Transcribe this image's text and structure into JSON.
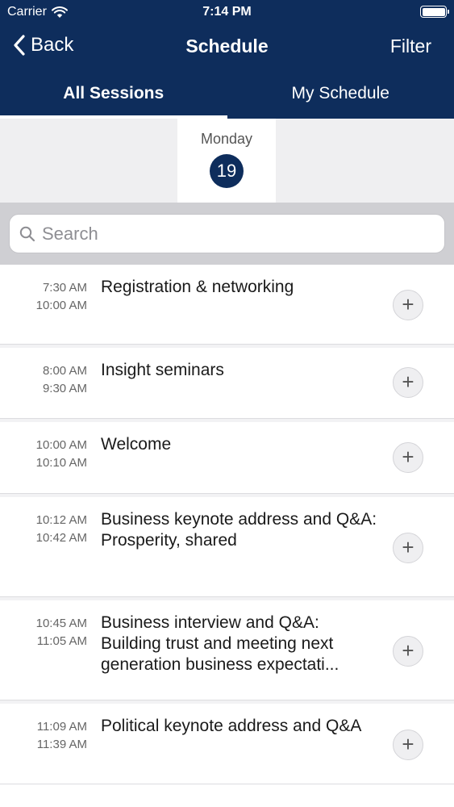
{
  "status": {
    "carrier": "Carrier",
    "time": "7:14 PM"
  },
  "nav": {
    "back_label": "Back",
    "title": "Schedule",
    "filter_label": "Filter"
  },
  "tabs": [
    {
      "label": "All Sessions",
      "active": true
    },
    {
      "label": "My Schedule",
      "active": false
    }
  ],
  "date": {
    "weekday": "Monday",
    "day": "19"
  },
  "search": {
    "placeholder": "Search"
  },
  "sessions": [
    {
      "start": "7:30 AM",
      "end": "10:00 AM",
      "title": "Registration & networking"
    },
    {
      "start": "8:00 AM",
      "end": "9:30 AM",
      "title": "Insight seminars"
    },
    {
      "start": "10:00 AM",
      "end": "10:10 AM",
      "title": "Welcome"
    },
    {
      "start": "10:12 AM",
      "end": "10:42 AM",
      "title": "Business keynote address and Q&A: Prosperity, shared"
    },
    {
      "start": "10:45 AM",
      "end": "11:05 AM",
      "title": "Business interview and Q&A: Building trust and meeting next generation business expectati..."
    },
    {
      "start": "11:09 AM",
      "end": "11:39 AM",
      "title": "Political keynote address and Q&A"
    }
  ],
  "colors": {
    "header_bg": "#0e2d5c",
    "accent": "#0e2d5c"
  },
  "icons": [
    "wifi-icon",
    "battery-icon",
    "chevron-left-icon",
    "search-icon",
    "plus-icon"
  ]
}
